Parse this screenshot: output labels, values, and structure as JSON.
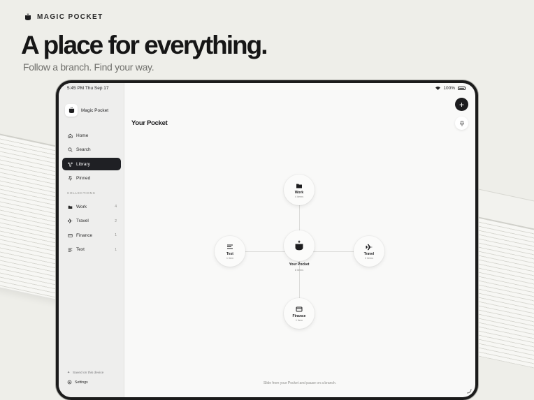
{
  "brand": {
    "name": "MAGIC POCKET"
  },
  "hero": {
    "headline": "A place for everything.",
    "subhead": "Follow a branch. Find your way."
  },
  "status_bar": {
    "time": "5:45 PM   Thu Sep 17",
    "battery": "100%"
  },
  "sidebar": {
    "app_name": "Magic Pocket",
    "nav": [
      {
        "label": "Home",
        "icon": "home-icon"
      },
      {
        "label": "Search",
        "icon": "search-icon"
      },
      {
        "label": "Library",
        "icon": "library-icon",
        "active": true
      },
      {
        "label": "Pinned",
        "icon": "pin-icon"
      }
    ],
    "collections_label": "COLLECTIONS",
    "collections": [
      {
        "label": "Work",
        "count": "4",
        "icon": "folder-icon"
      },
      {
        "label": "Travel",
        "count": "2",
        "icon": "airplane-icon"
      },
      {
        "label": "Finance",
        "count": "1",
        "icon": "card-icon"
      },
      {
        "label": "Text",
        "count": "1",
        "icon": "text-icon"
      }
    ],
    "saved_note": "Saved on this device",
    "settings_label": "Settings"
  },
  "main": {
    "title": "Your Pocket",
    "center": {
      "label": "Your Pocket",
      "sub": "8 items"
    },
    "nodes": {
      "work": {
        "label": "Work",
        "sub": "4 items"
      },
      "text": {
        "label": "Text",
        "sub": "1 item"
      },
      "travel": {
        "label": "Travel",
        "sub": "2 items"
      },
      "finance": {
        "label": "Finance",
        "sub": "1 item"
      }
    },
    "hint": "Slide from your Pocket and pause on a branch."
  },
  "colors": {
    "accent": "#1f2024",
    "background": "#eeeee9"
  }
}
